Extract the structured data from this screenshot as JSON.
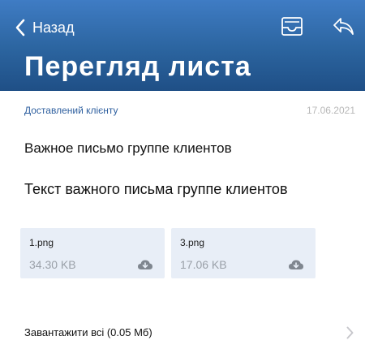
{
  "header": {
    "back_label": "Назад",
    "title": "Перегляд листа",
    "back_icon": "chevron-left-icon",
    "archive_icon": "archive-tray-icon",
    "reply_icon": "reply-icon",
    "colors": {
      "gradient_top": "#3f7cc4",
      "gradient_bottom": "#1f4f86",
      "text": "#ffffff"
    }
  },
  "message": {
    "status": "Доставлений клієнту",
    "date": "17.06.2021",
    "subject": "Важное письмо группе клиентов",
    "body": "Текст важного письма группе клиентов"
  },
  "attachments": [
    {
      "name": "1.png",
      "size": "34.30 KB",
      "icon": "cloud-download-icon"
    },
    {
      "name": "3.png",
      "size": "17.06 KB",
      "icon": "cloud-download-icon"
    }
  ],
  "download_all": {
    "label": "Завантажити всі (0.05 Мб)",
    "icon": "chevron-right-icon"
  }
}
